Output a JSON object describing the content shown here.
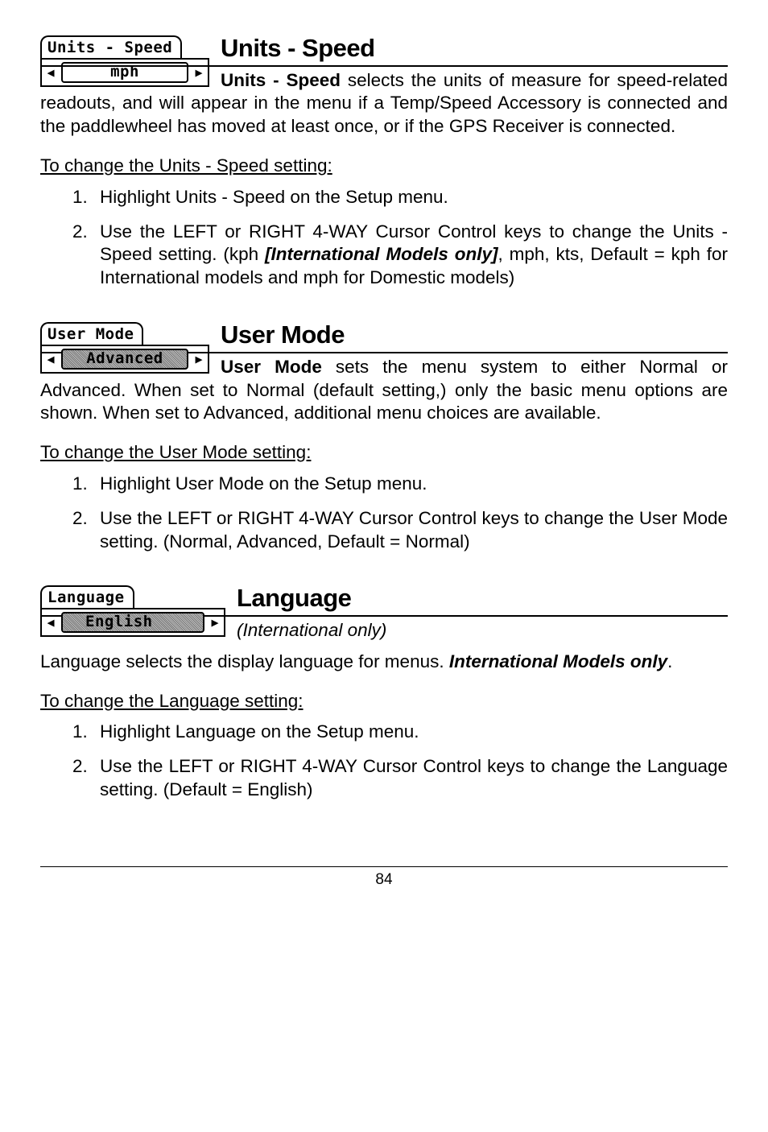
{
  "sections": {
    "speed": {
      "widget_title": "Units - Speed",
      "widget_value": "mph",
      "heading": "Units - Speed",
      "lead_bold": "Units - Speed",
      "lead_rest": " selects the units of measure for speed-related readouts, and will appear in the menu if a Temp/Speed Accessory is connected and the paddlewheel has moved at least once, or if the GPS Receiver is connected.",
      "subhead": "To change the Units - Speed setting:",
      "steps": {
        "s1": "Highlight Units - Speed on the Setup menu.",
        "s2a": "Use the LEFT or RIGHT 4-WAY Cursor Control keys to change the Units - Speed setting. (kph ",
        "s2b": "[International Models only]",
        "s2c": ", mph, kts, Default = kph for International models and mph for Domestic models)"
      }
    },
    "usermode": {
      "widget_title": "User  Mode",
      "widget_value": "Advanced",
      "heading": "User Mode",
      "lead_bold": "User Mode",
      "lead_rest": " sets the menu system to either Normal or Advanced. When set to Normal (default setting,) only the basic menu options are shown.  When set to Advanced, additional menu choices are available.",
      "subhead": "To change the User Mode setting:",
      "steps": {
        "s1": "Highlight User Mode on the Setup menu.",
        "s2": "Use the LEFT or RIGHT 4-WAY Cursor Control keys to change the User Mode setting. (Normal, Advanced, Default = Normal)"
      }
    },
    "language": {
      "widget_title": "Language",
      "widget_value": "English",
      "heading": "Language",
      "subnote": "(International only)",
      "line_bold1": "Language",
      "line_mid": " selects the display language for menus. ",
      "line_bold2": "International Models only",
      "line_end": ".",
      "subhead": "To change the Language setting:",
      "steps": {
        "s1": "Highlight Language on the Setup menu.",
        "s2": "Use the LEFT or RIGHT 4-WAY Cursor Control keys to change the Language setting. (Default = English)"
      }
    }
  },
  "page_number": "84",
  "arrows": {
    "left": "◀",
    "right": "▶"
  }
}
